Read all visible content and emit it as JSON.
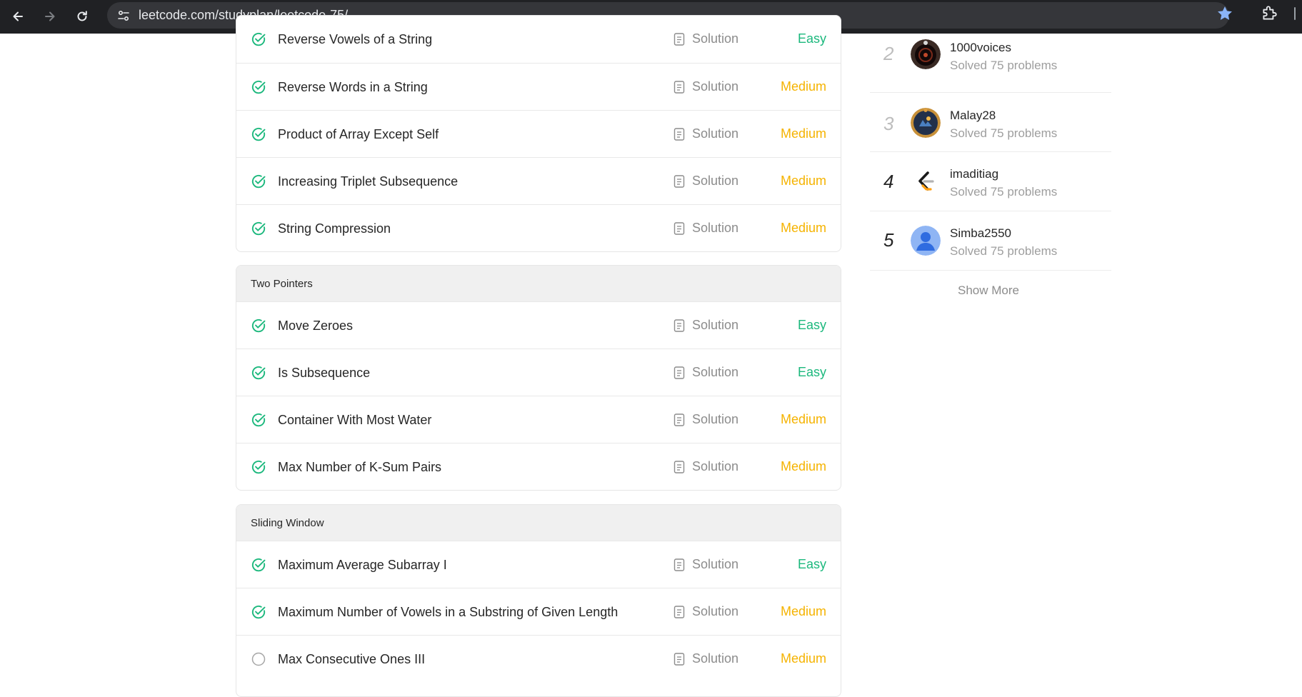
{
  "browser": {
    "url": "leetcode.com/studyplan/leetcode-75/",
    "icons": [
      "back-arrow-icon",
      "forward-arrow-icon",
      "reload-icon",
      "site-settings-icon",
      "bookmark-star-icon",
      "extensions-icon"
    ],
    "accent": "#8ab4f8"
  },
  "colors": {
    "easy": "#1cb87d",
    "medium": "#f5b300",
    "check": "#1cb87d"
  },
  "groups": [
    {
      "name": "",
      "problems": [
        {
          "title": "Reverse Vowels of a String",
          "solution": "Solution",
          "difficulty": "Easy",
          "solved": true
        },
        {
          "title": "Reverse Words in a String",
          "solution": "Solution",
          "difficulty": "Medium",
          "solved": true
        },
        {
          "title": "Product of Array Except Self",
          "solution": "Solution",
          "difficulty": "Medium",
          "solved": true
        },
        {
          "title": "Increasing Triplet Subsequence",
          "solution": "Solution",
          "difficulty": "Medium",
          "solved": true
        },
        {
          "title": "String Compression",
          "solution": "Solution",
          "difficulty": "Medium",
          "solved": true
        }
      ]
    },
    {
      "name": "Two Pointers",
      "problems": [
        {
          "title": "Move Zeroes",
          "solution": "Solution",
          "difficulty": "Easy",
          "solved": true
        },
        {
          "title": "Is Subsequence",
          "solution": "Solution",
          "difficulty": "Easy",
          "solved": true
        },
        {
          "title": "Container With Most Water",
          "solution": "Solution",
          "difficulty": "Medium",
          "solved": true
        },
        {
          "title": "Max Number of K-Sum Pairs",
          "solution": "Solution",
          "difficulty": "Medium",
          "solved": true
        }
      ]
    },
    {
      "name": "Sliding Window",
      "problems": [
        {
          "title": "Maximum Average Subarray I",
          "solution": "Solution",
          "difficulty": "Easy",
          "solved": true
        },
        {
          "title": "Maximum Number of Vowels in a Substring of Given Length",
          "solution": "Solution",
          "difficulty": "Medium",
          "solved": true
        },
        {
          "title": "Max Consecutive Ones III",
          "solution": "Solution",
          "difficulty": "Medium",
          "solved": false
        }
      ]
    }
  ],
  "leaderboard": {
    "entries": [
      {
        "rank": "2",
        "name": "1000voices",
        "solved": "Solved 75 problems",
        "avatar": "dark-orb-avatar"
      },
      {
        "rank": "3",
        "name": "Malay28",
        "solved": "Solved 75 problems",
        "avatar": "badge-avatar"
      },
      {
        "rank": "4",
        "name": "imaditiag",
        "solved": "Solved 75 problems",
        "avatar": "leetcode-logo-avatar"
      },
      {
        "rank": "5",
        "name": "Simba2550",
        "solved": "Solved 75 problems",
        "avatar": "default-user-avatar"
      }
    ],
    "show_more": "Show More"
  }
}
